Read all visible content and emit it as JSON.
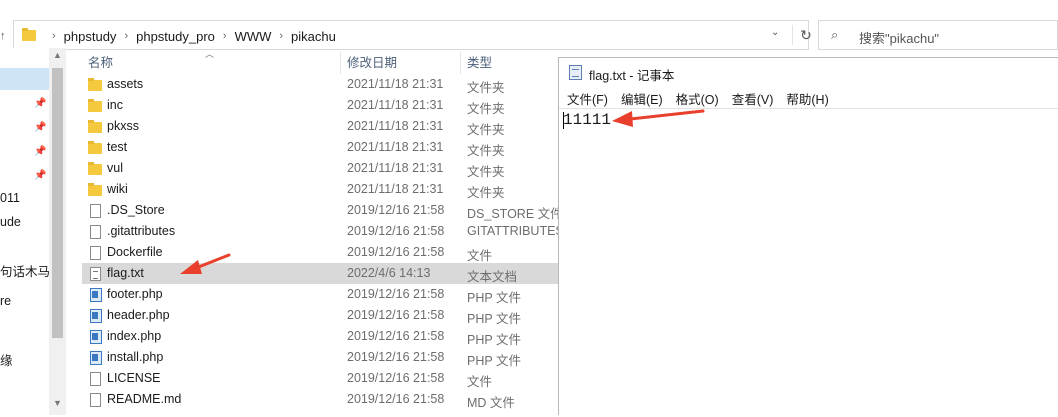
{
  "explorer": {
    "breadcrumb": [
      "phpstudy",
      "phpstudy_pro",
      "WWW",
      "pikachu"
    ],
    "search_placeholder": "搜索\"pikachu\"",
    "columns": {
      "name": "名称",
      "date": "修改日期",
      "type": "类型"
    },
    "nav_items": [
      "011",
      "ude",
      "句话木马注",
      "re",
      "缘"
    ],
    "files": [
      {
        "name": "assets",
        "date": "2021/11/18 21:31",
        "type": "文件夹",
        "icon": "folder-icon"
      },
      {
        "name": "inc",
        "date": "2021/11/18 21:31",
        "type": "文件夹",
        "icon": "folder-icon"
      },
      {
        "name": "pkxss",
        "date": "2021/11/18 21:31",
        "type": "文件夹",
        "icon": "folder-icon"
      },
      {
        "name": "test",
        "date": "2021/11/18 21:31",
        "type": "文件夹",
        "icon": "folder-icon"
      },
      {
        "name": "vul",
        "date": "2021/11/18 21:31",
        "type": "文件夹",
        "icon": "folder-icon"
      },
      {
        "name": "wiki",
        "date": "2021/11/18 21:31",
        "type": "文件夹",
        "icon": "folder-icon"
      },
      {
        "name": ".DS_Store",
        "date": "2019/12/16 21:58",
        "type": "DS_STORE 文件",
        "icon": "file-icon"
      },
      {
        "name": ".gitattributes",
        "date": "2019/12/16 21:58",
        "type": "GITATTRIBUTES",
        "icon": "file-icon"
      },
      {
        "name": "Dockerfile",
        "date": "2019/12/16 21:58",
        "type": "文件",
        "icon": "file-icon"
      },
      {
        "name": "flag.txt",
        "date": "2022/4/6 14:13",
        "type": "文本文档",
        "icon": "text-file-icon",
        "selected": true
      },
      {
        "name": "footer.php",
        "date": "2019/12/16 21:58",
        "type": "PHP 文件",
        "icon": "php-file-icon"
      },
      {
        "name": "header.php",
        "date": "2019/12/16 21:58",
        "type": "PHP 文件",
        "icon": "php-file-icon"
      },
      {
        "name": "index.php",
        "date": "2019/12/16 21:58",
        "type": "PHP 文件",
        "icon": "php-file-icon"
      },
      {
        "name": "install.php",
        "date": "2019/12/16 21:58",
        "type": "PHP 文件",
        "icon": "php-file-icon"
      },
      {
        "name": "LICENSE",
        "date": "2019/12/16 21:58",
        "type": "文件",
        "icon": "file-icon"
      },
      {
        "name": "README.md",
        "date": "2019/12/16 21:58",
        "type": "MD 文件",
        "icon": "file-icon"
      }
    ]
  },
  "notepad": {
    "title": "flag.txt - 记事本",
    "menu": [
      "文件(F)",
      "编辑(E)",
      "格式(O)",
      "查看(V)",
      "帮助(H)"
    ],
    "content": "11111"
  },
  "annotation_color": "#e8402c"
}
